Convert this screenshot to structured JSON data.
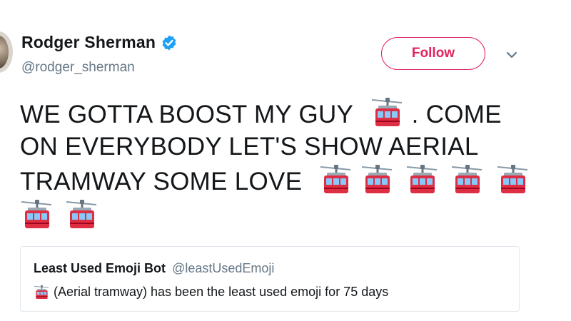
{
  "tweet": {
    "display_name": "Rodger Sherman",
    "handle": "@rodger_sherman",
    "follow_label": "Follow",
    "text_lines": [
      "WE GOTTA BOOST MY GUY",
      ". COME",
      "ON EVERYBODY LET'S SHOW AERIAL",
      "TRAMWAY SOME LOVE"
    ],
    "tram_emoji": "🚡",
    "icons": [
      "avatar",
      "verified-badge-icon",
      "chevron-down-icon",
      "aerial-tramway-icon"
    ]
  },
  "quoted_tweet": {
    "display_name": "Least Used Emoji Bot",
    "handle": "@leastUsedEmoji",
    "text": "(Aerial tramway) has been the least used emoji for 75 days"
  },
  "colors": {
    "follow_accent": "#e0245e",
    "verified_blue": "#1da1f2",
    "secondary_text": "#657786",
    "tram_red": "#dd2e44",
    "tram_blue": "#88c9f9"
  }
}
